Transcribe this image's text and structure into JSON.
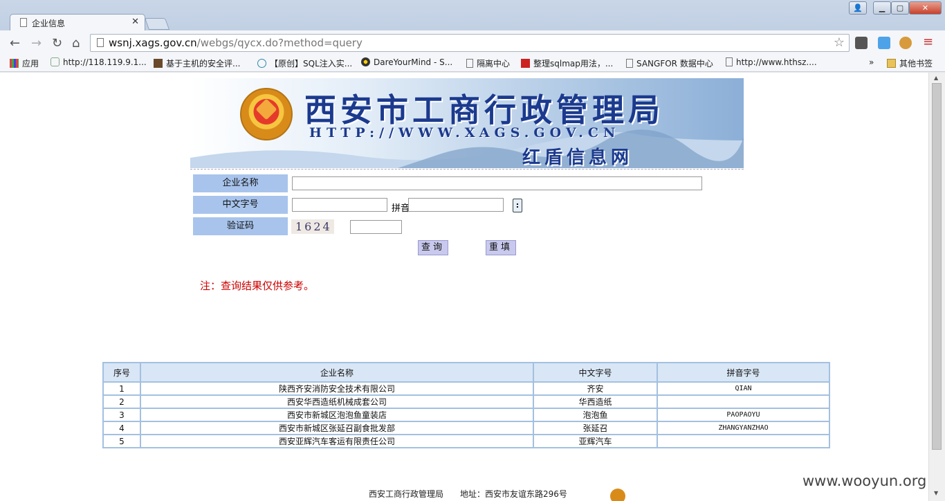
{
  "browser": {
    "tab_title": "企业信息",
    "url_host": "wsnj.xags.gov.cn",
    "url_path": "/webgs/qycx.do?method=query",
    "bookmarks": [
      "应用",
      "http://118.119.9.1...",
      "基于主机的安全评...",
      "【原创】SQL注入实...",
      "DareYourMind - S...",
      "隔离中心",
      "整理sqlmap用法，...",
      "SANGFOR 数据中心",
      "http://www.hthsz....",
      "»",
      "其他书签"
    ]
  },
  "banner": {
    "title": "西安市工商行政管理局",
    "url": "HTTP://WWW.XAGS.GOV.CN",
    "subtitle": "红盾信息网"
  },
  "form": {
    "company_name_label": "企业名称",
    "chinese_name_label": "中文字号",
    "pinyin_label": "拼音",
    "captcha_label": "验证码",
    "captcha_value": "1624",
    "keyboard_button": ":",
    "search_button": "查询",
    "reset_button": "重填",
    "note": "注：查询结果仅供参考。"
  },
  "results": {
    "headers": [
      "序号",
      "企业名称",
      "中文字号",
      "拼音字号"
    ],
    "rows": [
      [
        "1",
        "陕西齐安消防安全技术有限公司",
        "齐安",
        "QIAN"
      ],
      [
        "2",
        "西安华西造纸机械成套公司",
        "华西造纸",
        ""
      ],
      [
        "3",
        "西安市新城区泡泡鱼童装店",
        "泡泡鱼",
        "PAOPAOYU"
      ],
      [
        "4",
        "西安市新城区张延召副食批发部",
        "张延召",
        "ZHANGYANZHAO"
      ],
      [
        "5",
        "西安亚辉汽车客运有限责任公司",
        "亚辉汽车",
        ""
      ]
    ]
  },
  "footer": {
    "text": "西安工商行政管理局　　地址：西安市友谊东路296号"
  },
  "watermark": "www.wooyun.org"
}
